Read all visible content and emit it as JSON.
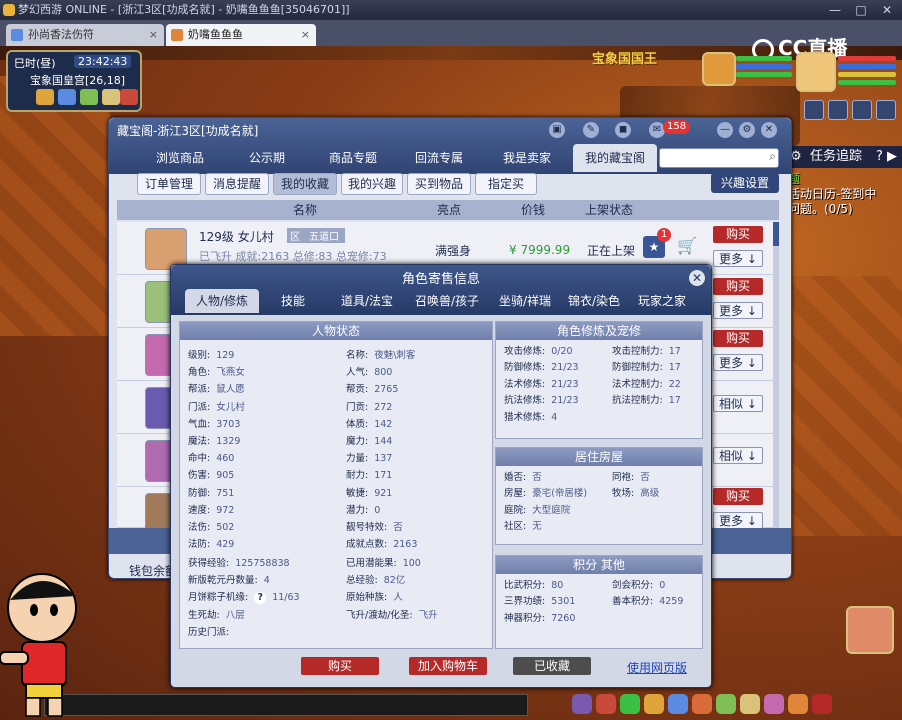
{
  "titlebar": {
    "title": "梦幻西游 ONLINE - [浙江3区[功成名就] - 奶嘴鱼鱼鱼[35046701]]"
  },
  "browser_tabs": [
    {
      "label": "孙尚香法伤符"
    },
    {
      "label": "奶嘴鱼鱼鱼"
    }
  ],
  "hud": {
    "time_label": "巳时(昼)",
    "clock": "23:42:43",
    "location_coords": "宝象国皇宫[26,18]",
    "scene_name": "宝象国国王",
    "stream_logo": "CC直播",
    "task_track": "任务追踪",
    "task_text_highlight": "活动日历-签到中",
    "task_text_line2": "问题。(0/5)",
    "task_title_short": "题"
  },
  "cbg": {
    "title": "藏宝阁-浙江3区[功成名就]",
    "badge_count": "158",
    "nav_tabs": [
      "浏览商品",
      "公示期",
      "商品专题",
      "回流专属",
      "我是卖家",
      "我的藏宝阁"
    ],
    "sub_tabs": [
      "订单管理",
      "消息提醒",
      "我的收藏",
      "我的兴趣",
      "买到物品",
      "指定买"
    ],
    "interest_button": "兴趣设置",
    "columns": {
      "name": "名称",
      "highlight": "亮点",
      "price": "价钱",
      "status": "上架状态"
    },
    "first_row": {
      "level_school": "129级  女儿村",
      "tag1": "区",
      "tag2": "五道口",
      "line2": "已飞升  成就:2163  总修:83  总宠修:73",
      "highlight": "满强身",
      "price": "¥ 7999.99",
      "status": "正在上架",
      "star_badge": "1"
    },
    "buy_label": "购买",
    "more_label": "更多",
    "similar_label": "相似",
    "wallet": "钱包余额"
  },
  "detail": {
    "title": "角色寄售信息",
    "tabs": [
      "人物/修炼",
      "技能",
      "道具/法宝",
      "召唤兽/孩子",
      "坐骑/祥瑞",
      "锦衣/染色",
      "玩家之家"
    ],
    "status_panel_title": "人物状态",
    "status_left": [
      {
        "k": "级别:",
        "v": "129"
      },
      {
        "k": "角色:",
        "v": "飞燕女"
      },
      {
        "k": "帮派:",
        "v": "鼠人愿"
      },
      {
        "k": "门派:",
        "v": "女儿村"
      },
      {
        "k": "气血:",
        "v": "3703"
      },
      {
        "k": "魔法:",
        "v": "1329"
      },
      {
        "k": "命中:",
        "v": "460"
      },
      {
        "k": "伤害:",
        "v": "905"
      },
      {
        "k": "防御:",
        "v": "751"
      },
      {
        "k": "速度:",
        "v": "972"
      },
      {
        "k": "法伤:",
        "v": "502"
      },
      {
        "k": "法防:",
        "v": "429"
      }
    ],
    "status_right": [
      {
        "k": "名称:",
        "v": "夜魅\\刺客"
      },
      {
        "k": "人气:",
        "v": "800"
      },
      {
        "k": "帮贡:",
        "v": "2765"
      },
      {
        "k": "门贡:",
        "v": "272"
      },
      {
        "k": "体质:",
        "v": "142"
      },
      {
        "k": "魔力:",
        "v": "144"
      },
      {
        "k": "力量:",
        "v": "137"
      },
      {
        "k": "耐力:",
        "v": "171"
      },
      {
        "k": "敏捷:",
        "v": "921"
      },
      {
        "k": "潜力:",
        "v": "0"
      },
      {
        "k": "靓号特效:",
        "v": "否"
      },
      {
        "k": "成就点数:",
        "v": "2163"
      }
    ],
    "status_extra": [
      {
        "k": "获得经验:",
        "v": "125758838",
        "k2": "已用潜能果:",
        "v2": "100"
      },
      {
        "k": "新版乾元丹数量:",
        "v": "4",
        "k2": "总经验:",
        "v2": "82亿"
      },
      {
        "k": "月饼粽子机缘:",
        "v": "11/63",
        "k2": "原始种族:",
        "v2": "人"
      },
      {
        "k": "生死劫:",
        "v": "八层",
        "k2": "飞升/渡劫/化圣:",
        "v2": "飞升"
      },
      {
        "k": "历史门派:",
        "v": "",
        "k2": "",
        "v2": ""
      }
    ],
    "help_icon": "?",
    "cult_panel_title": "角色修炼及宠修",
    "cultivation": [
      {
        "k": "攻击修炼:",
        "v": "0/20",
        "k2": "攻击控制力:",
        "v2": "17"
      },
      {
        "k": "防御修炼:",
        "v": "21/23",
        "k2": "防御控制力:",
        "v2": "17"
      },
      {
        "k": "法术修炼:",
        "v": "21/23",
        "k2": "法术控制力:",
        "v2": "22"
      },
      {
        "k": "抗法修炼:",
        "v": "21/23",
        "k2": "抗法控制力:",
        "v2": "17"
      },
      {
        "k": "猎术修炼:",
        "v": "4",
        "k2": "",
        "v2": ""
      }
    ],
    "house_panel_title": "居住房屋",
    "house": [
      {
        "k": "婚否:",
        "v": "否",
        "k2": "同袍:",
        "v2": "否"
      },
      {
        "k": "房屋:",
        "v": "豪宅(帝居楼)",
        "k2": "牧场:",
        "v2": "高级"
      },
      {
        "k": "庭院:",
        "v": "大型庭院",
        "k2": "",
        "v2": ""
      },
      {
        "k": "社区:",
        "v": "无",
        "k2": "",
        "v2": ""
      }
    ],
    "score_panel_title": "积分 其他",
    "scores": [
      {
        "k": "比武积分:",
        "v": "80",
        "k2": "剑会积分:",
        "v2": "0"
      },
      {
        "k": "三界功绩:",
        "v": "5301",
        "k2": "善本积分:",
        "v2": "4259"
      },
      {
        "k": "神器积分:",
        "v": "7260",
        "k2": "",
        "v2": ""
      }
    ],
    "buttons": {
      "buy": "购买",
      "cart": "加入购物车",
      "favorited": "已收藏",
      "web": "使用网页版"
    }
  },
  "colors": {
    "accent": "#2f4473",
    "buy": "#b52929",
    "price": "#2e9a3a",
    "link": "#1f46b6"
  }
}
